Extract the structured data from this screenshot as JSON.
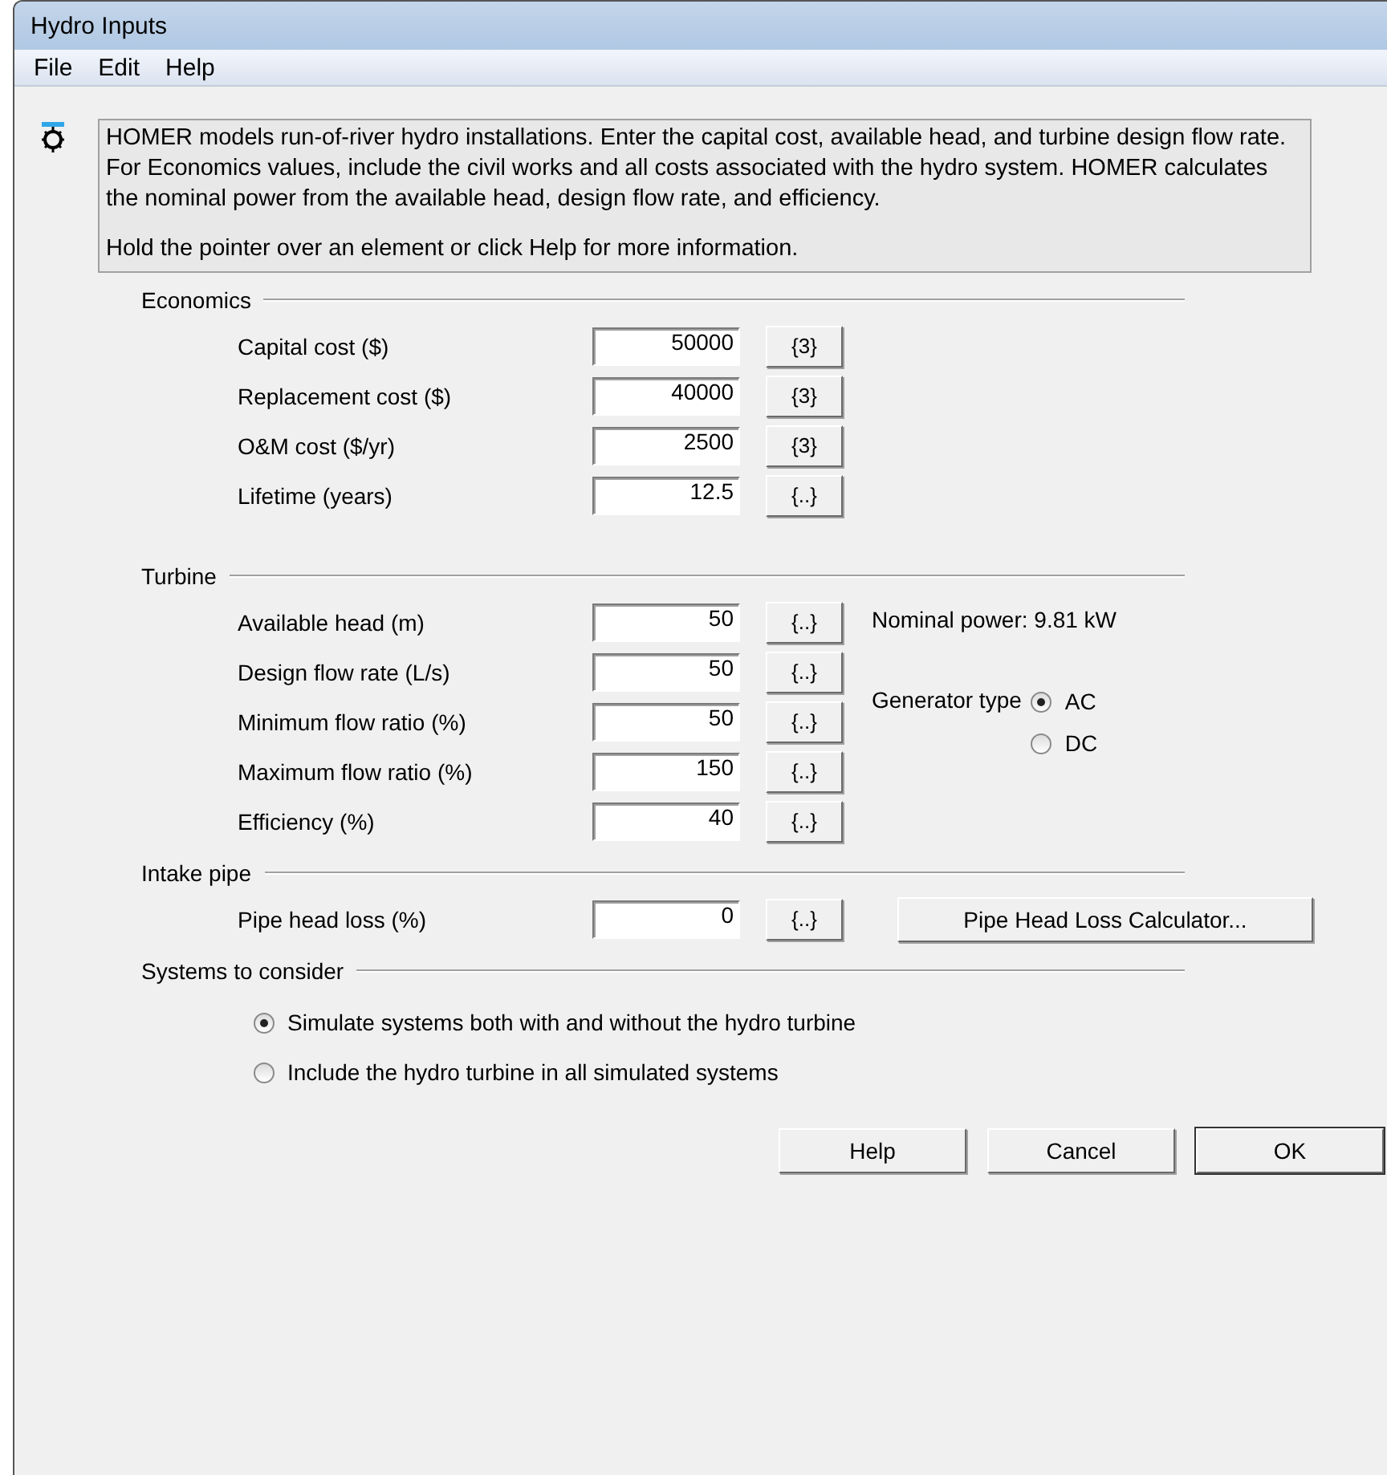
{
  "window": {
    "title": "Hydro Inputs"
  },
  "menu": [
    "File",
    "Edit",
    "Help"
  ],
  "info": {
    "paragraphs": [
      "HOMER models run-of-river hydro installations. Enter the capital cost, available head, and turbine design flow rate.  For Economics values, include the civil works and all costs associated with the hydro system. HOMER calculates the nominal power from the available head, design flow rate, and efficiency.",
      "Hold the pointer over an element or click Help for more information."
    ]
  },
  "sections": [
    {
      "title": "Economics",
      "fields": [
        {
          "label": "Capital  cost ($)",
          "value": "50000",
          "button": "{3}"
        },
        {
          "label": "Replacement cost ($)",
          "value": "40000",
          "button": "{3}"
        },
        {
          "label": "O&M cost ($/yr)",
          "value": "2500",
          "button": "{3}"
        },
        {
          "label": "Lifetime (years)",
          "value": "12.5",
          "button": "{..}"
        }
      ]
    },
    {
      "title": "Turbine",
      "fields": [
        {
          "label": "Available head (m)",
          "value": "50",
          "button": "{..}"
        },
        {
          "label": "Design flow rate (L/s)",
          "value": "50",
          "button": "{..}"
        },
        {
          "label": "Minimum flow ratio (%)",
          "value": "50",
          "button": "{..}"
        },
        {
          "label": "Maximum flow ratio (%)",
          "value": "150",
          "button": "{..}"
        },
        {
          "label": "Efficiency (%)",
          "value": "40",
          "button": "{..}"
        }
      ],
      "nominal_power": "Nominal power: 9.81 kW",
      "generator_type": {
        "label": "Generator type",
        "options": [
          {
            "label": "AC",
            "selected": true
          },
          {
            "label": "DC",
            "selected": false
          }
        ]
      }
    },
    {
      "title": "Intake pipe",
      "fields": [
        {
          "label": "Pipe head loss (%)",
          "value": "0",
          "button": "{..}"
        }
      ],
      "action_button": "Pipe Head Loss Calculator..."
    },
    {
      "title": "Systems to consider",
      "options": [
        {
          "label": "Simulate systems both with and without the hydro turbine",
          "selected": true
        },
        {
          "label": "Include the hydro turbine in all simulated systems",
          "selected": false
        }
      ]
    }
  ],
  "buttons": [
    "Help",
    "Cancel",
    "OK"
  ]
}
